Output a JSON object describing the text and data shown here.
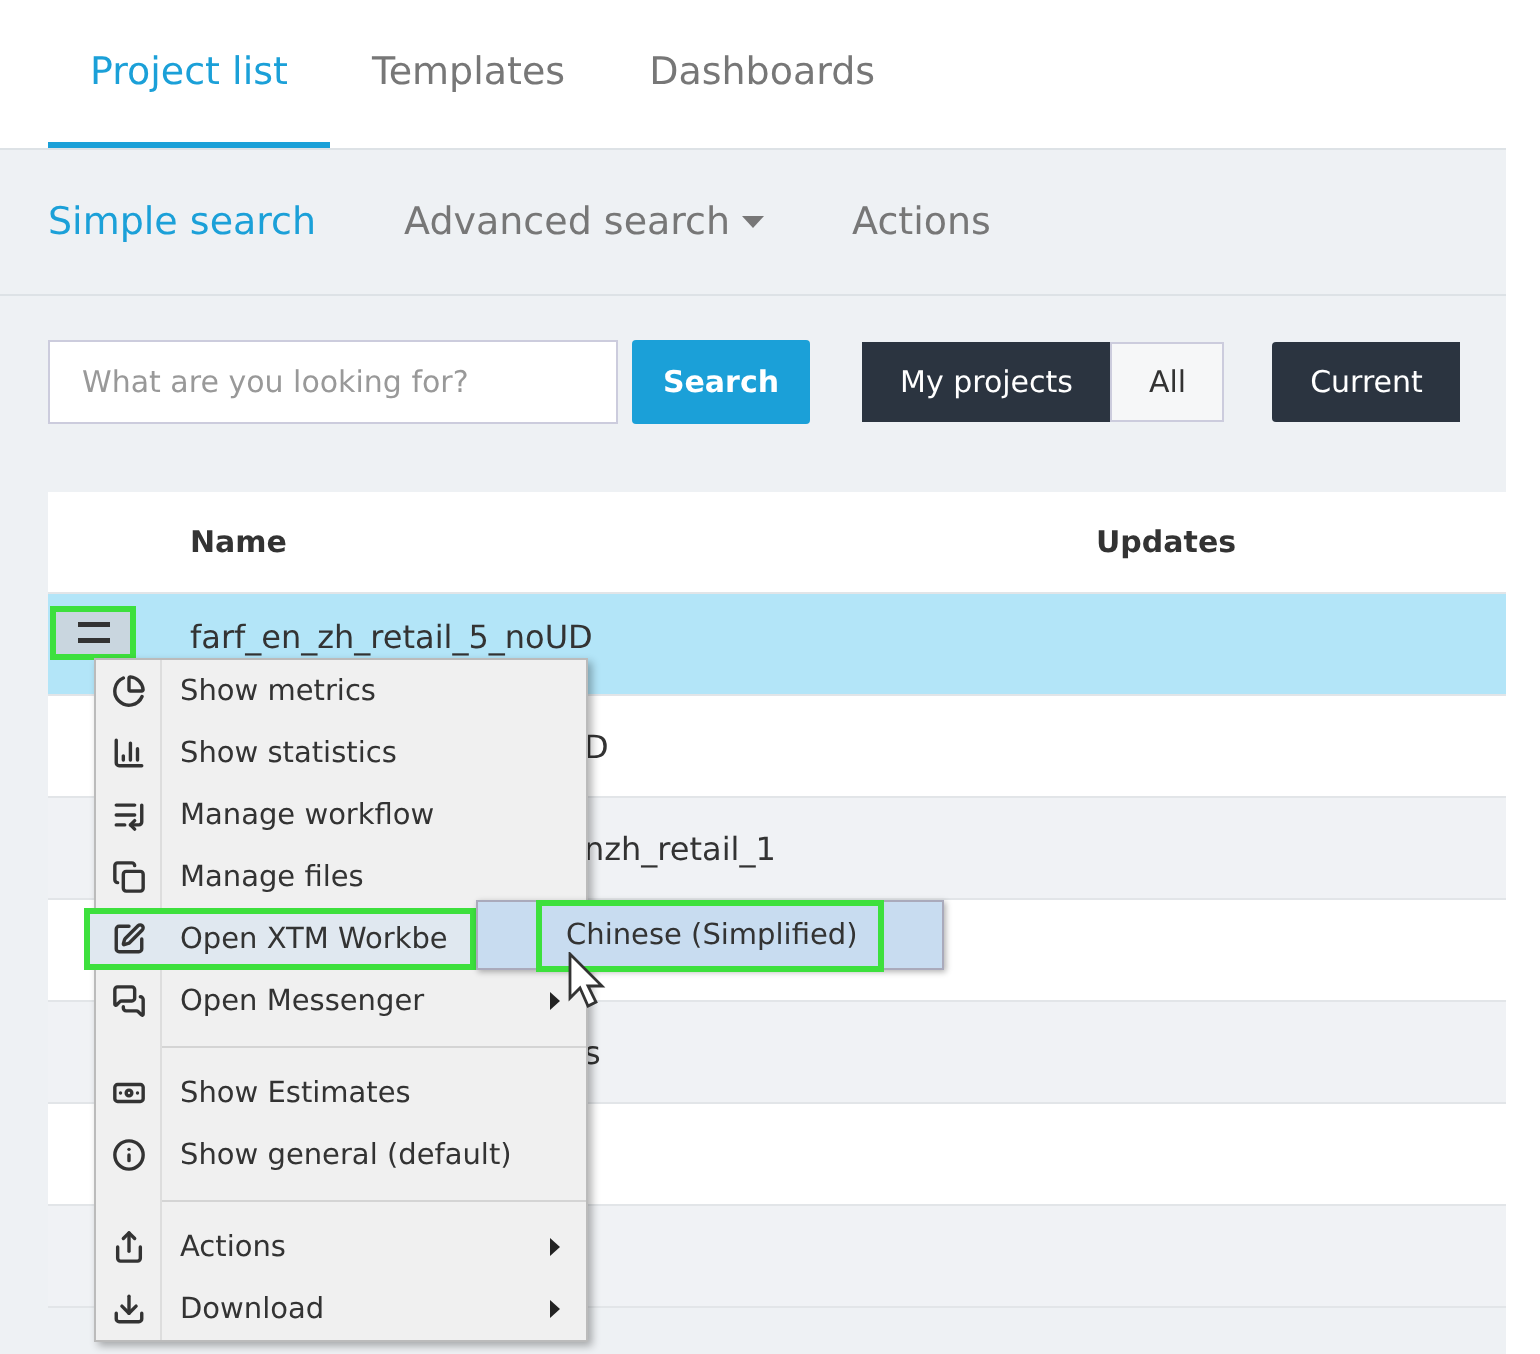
{
  "tabs": [
    {
      "label": "Project list",
      "selected": true
    },
    {
      "label": "Templates",
      "selected": false
    },
    {
      "label": "Dashboards",
      "selected": false
    }
  ],
  "subnav": [
    {
      "label": "Simple search",
      "selected": true,
      "dropdown": false
    },
    {
      "label": "Advanced search",
      "selected": false,
      "dropdown": true
    },
    {
      "label": "Actions",
      "selected": false,
      "dropdown": false
    }
  ],
  "search": {
    "placeholder": "What are you looking for?",
    "button": "Search"
  },
  "scope_toggle": [
    {
      "label": "My projects",
      "selected": true
    },
    {
      "label": "All",
      "selected": false
    }
  ],
  "status_filter": {
    "label": "Current"
  },
  "table": {
    "columns": [
      "Name",
      "Updates"
    ],
    "rows": [
      {
        "name": "farf_en_zh_retail_5_noUD",
        "selected": true,
        "obscured": false
      },
      {
        "name": "D",
        "selected": false,
        "obscured": true
      },
      {
        "name": "nzh_retail_1",
        "selected": false,
        "obscured": true
      },
      {
        "selected": false
      },
      {
        "name": "s",
        "selected": false,
        "obscured": true
      },
      {
        "selected": false
      },
      {
        "selected": false
      }
    ]
  },
  "row_menu_button": {
    "highlighted": true
  },
  "context_menu": {
    "items": [
      {
        "label": "Show metrics",
        "submenu": false,
        "separator_before": false,
        "highlighted": false
      },
      {
        "label": "Show statistics",
        "submenu": false,
        "separator_before": false,
        "highlighted": false
      },
      {
        "label": "Manage workflow",
        "submenu": false,
        "separator_before": false,
        "highlighted": false
      },
      {
        "label": "Manage files",
        "submenu": false,
        "separator_before": false,
        "highlighted": false
      },
      {
        "label": "Open XTM Workbe",
        "submenu": false,
        "separator_before": false,
        "highlighted": true
      },
      {
        "label": "Open Messenger",
        "submenu": true,
        "separator_before": false,
        "highlighted": false
      },
      {
        "label": "Show Estimates",
        "submenu": false,
        "separator_before": true,
        "highlighted": false
      },
      {
        "label": "Show general (default)",
        "submenu": false,
        "separator_before": false,
        "highlighted": false
      },
      {
        "label": "Actions",
        "submenu": true,
        "separator_before": true,
        "highlighted": false
      },
      {
        "label": "Download",
        "submenu": true,
        "separator_before": false,
        "highlighted": false
      }
    ]
  },
  "submenu": {
    "items": [
      {
        "label": "Chinese (Simplified)",
        "highlighted": true
      }
    ]
  }
}
